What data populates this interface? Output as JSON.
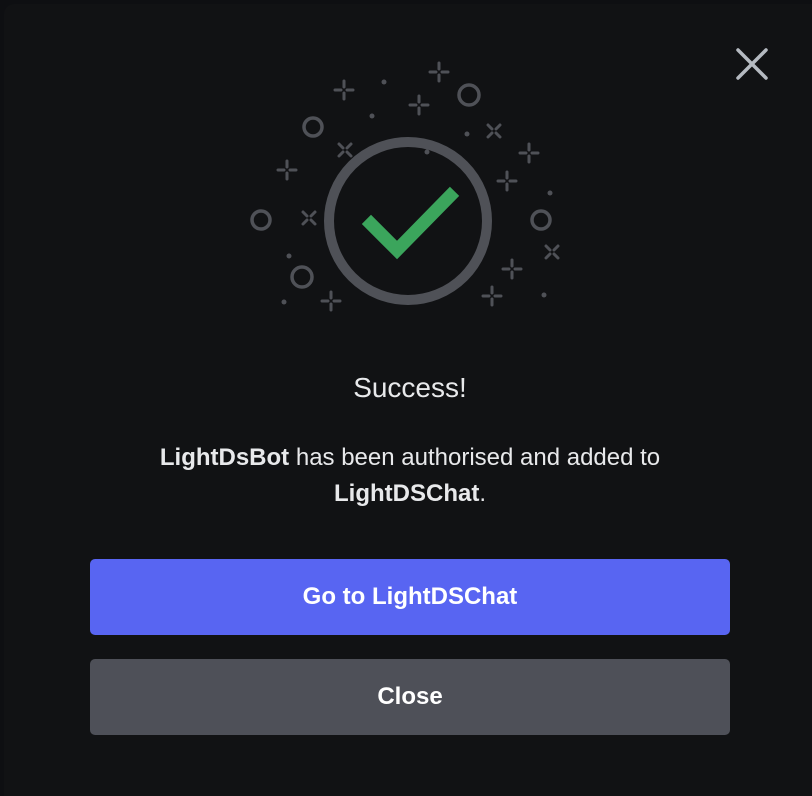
{
  "dialog": {
    "title": "Success!",
    "bot_name": "LightDsBot",
    "message_middle": " has been authorised and added to ",
    "server_name": "LightDSChat",
    "message_end": ".",
    "close_icon": "close-x-icon",
    "illustration_icon": "success-checkmark-icon"
  },
  "buttons": {
    "primary_label": "Go to LightDSChat",
    "secondary_label": "Close"
  },
  "colors": {
    "background": "#111214",
    "primary_button": "#5865f2",
    "secondary_button": "#4e5058",
    "checkmark": "#3ba55c",
    "decoration": "#4f5157",
    "text": "#e8e9eb"
  }
}
